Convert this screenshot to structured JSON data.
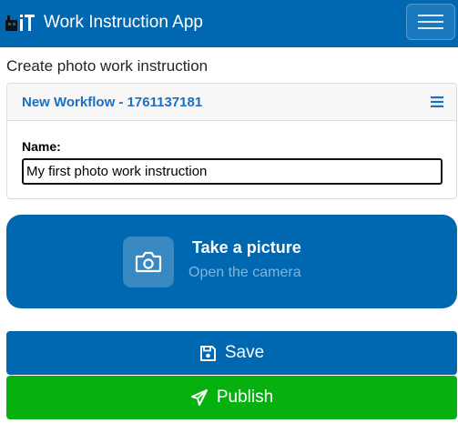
{
  "header": {
    "logo_text": "IT",
    "app_title": "Work Instruction App",
    "menu_icon": "hamburger-icon"
  },
  "page": {
    "heading": "Create photo work instruction"
  },
  "workflow_card": {
    "title": "New Workflow - 1761137181",
    "menu_icon": "list-icon",
    "name_label": "Name:",
    "name_value": "My first photo work instruction"
  },
  "camera": {
    "icon": "camera-icon",
    "title": "Take a picture",
    "subtitle": "Open the camera"
  },
  "actions": {
    "save_label": "Save",
    "save_icon": "floppy-disk-icon",
    "publish_label": "Publish",
    "publish_icon": "paper-plane-icon"
  },
  "colors": {
    "primary": "#0068b0",
    "success": "#06b10f",
    "link": "#1a6fc0"
  }
}
